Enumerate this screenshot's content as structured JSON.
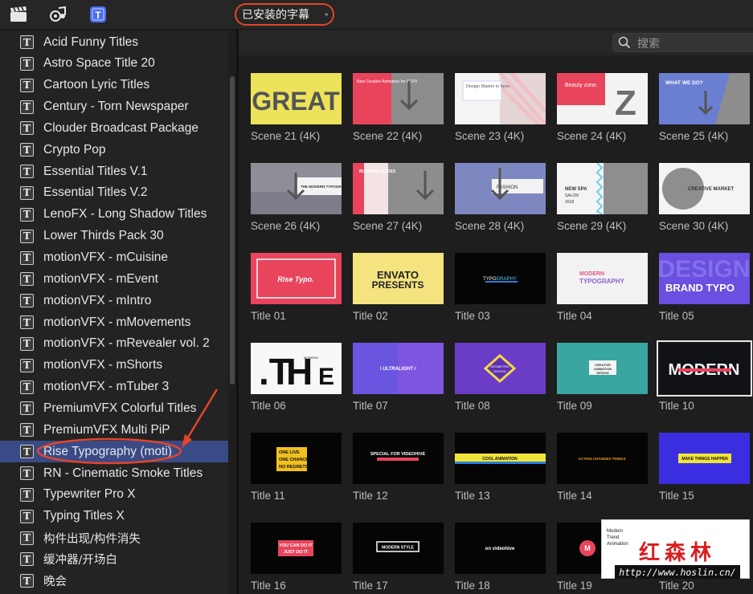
{
  "toolbar": {
    "icons": [
      "clapper-icon",
      "music-photo-icon",
      "titles-icon"
    ],
    "library_select": "已安装的字幕"
  },
  "search": {
    "placeholder": "搜索"
  },
  "sidebar": {
    "items": [
      {
        "label": "Acid Funny Titles"
      },
      {
        "label": "Astro Space Title 20"
      },
      {
        "label": "Cartoon Lyric Titles"
      },
      {
        "label": "Century - Torn Newspaper"
      },
      {
        "label": "Clouder Broadcast Package"
      },
      {
        "label": "Crypto Pop"
      },
      {
        "label": "Essential Titles V.1"
      },
      {
        "label": "Essential Titles V.2"
      },
      {
        "label": "LenoFX - Long Shadow Titles"
      },
      {
        "label": "Lower Thirds Pack 30"
      },
      {
        "label": "motionVFX - mCuisine"
      },
      {
        "label": "motionVFX - mEvent"
      },
      {
        "label": "motionVFX - mIntro"
      },
      {
        "label": "motionVFX - mMovements"
      },
      {
        "label": "motionVFX - mRevealer vol. 2"
      },
      {
        "label": "motionVFX - mShorts"
      },
      {
        "label": "motionVFX - mTuber 3"
      },
      {
        "label": "PremiumVFX Colorful Titles"
      },
      {
        "label": "PremiumVFX Multi PiP"
      },
      {
        "label": "Rise Typography (moti)",
        "selected": true
      },
      {
        "label": "RN - Cinematic Smoke Titles"
      },
      {
        "label": "Typewriter Pro X"
      },
      {
        "label": "Typing Titles X"
      },
      {
        "label": "构件出现/构件消失"
      },
      {
        "label": "缓冲器/开场白"
      },
      {
        "label": "晚会"
      }
    ]
  },
  "grid": {
    "items": [
      {
        "label": "Scene 21 (4K)",
        "art": "GREAT"
      },
      {
        "label": "Scene 22 (4K)",
        "art": "New Creative Animation for FCPX"
      },
      {
        "label": "Scene 23 (4K)",
        "art": "Design Master in here."
      },
      {
        "label": "Scene 24 (4K)",
        "art": "Beauty zone."
      },
      {
        "label": "Scene 25 (4K)",
        "art": "WHAT WE DO?"
      },
      {
        "label": "Scene 26 (4K)",
        "art": "THE MODERN TYPOGRAPHY"
      },
      {
        "label": "Scene 27 (4K)",
        "art": "BUSINESS SLIDES"
      },
      {
        "label": "Scene 28 (4K)",
        "art": "FASHION"
      },
      {
        "label": "Scene 29 (4K)",
        "art": "NEW SPA SALON 2018"
      },
      {
        "label": "Scene 30 (4K)",
        "art": "CREATIVE MARKET"
      },
      {
        "label": "Title 01",
        "art": "Rise Typo."
      },
      {
        "label": "Title 02",
        "art": "ENVATO PRESENTS"
      },
      {
        "label": "Title 03",
        "art": "TYPOGRAPHY"
      },
      {
        "label": "Title 04",
        "art": "MODERN TYPOGRAPHY"
      },
      {
        "label": "Title 05",
        "art": "BRAND TYPO"
      },
      {
        "label": "Title 06",
        "art": ".TH E"
      },
      {
        "label": "Title 07",
        "art": "ULTRALIGHT"
      },
      {
        "label": "Title 08",
        "art": "GEOMETRIC DESIGN"
      },
      {
        "label": "Title 09",
        "art": "CREATIVE ANIMATION DESIGN"
      },
      {
        "label": "Title 10",
        "art": "MODERN",
        "selected": true
      },
      {
        "label": "Title 11",
        "art": "ONE LIVE ONE CHANCE NO REGRETS"
      },
      {
        "label": "Title 12",
        "art": "SPECIAL FOR VIDEOHIVE"
      },
      {
        "label": "Title 13",
        "art": "COOL ANIMATION"
      },
      {
        "label": "Title 14",
        "art": "ACTION CHANGES THINGS"
      },
      {
        "label": "Title 15",
        "art": "MAKE THINGS HAPPEN"
      },
      {
        "label": "Title 16",
        "art": "YOU CAN DO IT JUST DO IT"
      },
      {
        "label": "Title 17",
        "art": "MODERN STYLE"
      },
      {
        "label": "Title 18",
        "art": "on videohive"
      },
      {
        "label": "Title 19",
        "art": "Modern Trend Animation"
      },
      {
        "label": "Title 20",
        "art": "TION"
      }
    ]
  },
  "watermark": {
    "cn": "红森林",
    "url": "http://www.hoslin.cn/"
  },
  "colors": {
    "selection": "#3a4a86",
    "annotation": "#e2452a"
  }
}
